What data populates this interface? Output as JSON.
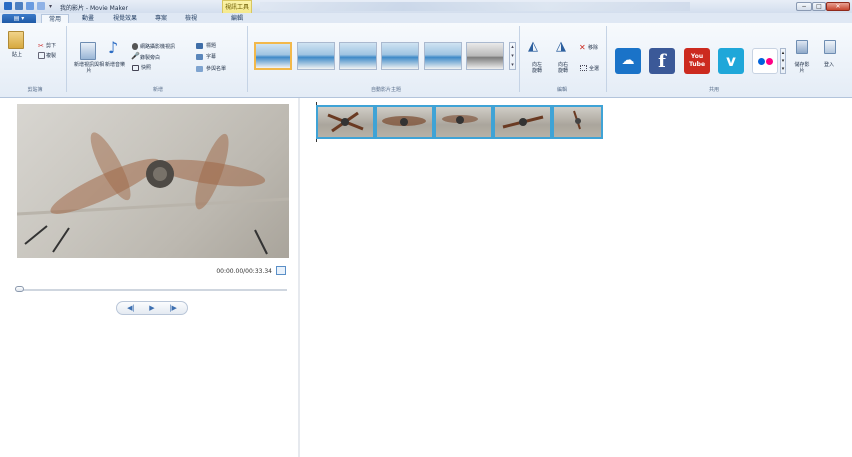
{
  "window": {
    "title": "我的影片 - Movie Maker",
    "context_tab_group": "視訊工具",
    "controls": {
      "minimize": "−",
      "maximize": "□",
      "close": "✕"
    }
  },
  "tabs": [
    "常用",
    "動畫",
    "視覺效果",
    "專案",
    "檢視",
    "編輯"
  ],
  "file_button": "▾",
  "ribbon": {
    "clipboard": {
      "paste": "貼上",
      "cut": "剪下",
      "copy": "複製",
      "label": "剪貼簿"
    },
    "add": {
      "add_videos_photos": "新增視訊與相片",
      "add_music": "新增音樂",
      "snapshot": "快照",
      "webcam_video": "網路攝影機視訊",
      "record_narration": "錄製旁白",
      "title": "標題",
      "caption": "字幕",
      "credits": "參與名單",
      "label": "新增"
    },
    "themes": {
      "label": "自動影片主題"
    },
    "editing": {
      "rotate_left": "向左旋轉",
      "rotate_right": "向右旋轉",
      "remove": "移除",
      "select_all": "全選",
      "label": "編輯"
    },
    "share": {
      "label": "共用",
      "services": [
        "onedrive-icon",
        "facebook-icon",
        "youtube-icon",
        "vimeo-icon",
        "flickr-icon"
      ],
      "youtube_text": "You Tube",
      "save_movie": "儲存影片",
      "sign_in": "登入"
    }
  },
  "player": {
    "timecode": "00:00.00/00:33.34",
    "progress": 0,
    "prev_frame": "◀|",
    "play": "▶",
    "next_frame": "|▶"
  },
  "colors": {
    "accent": "#2b6cc4",
    "facebook": "#3b5998",
    "youtube": "#cc2a1f",
    "vimeo": "#1fa7d9",
    "onedrive": "#1a73c8",
    "selection": "#f2b84a",
    "storyboard_border": "#3fa3d6"
  }
}
